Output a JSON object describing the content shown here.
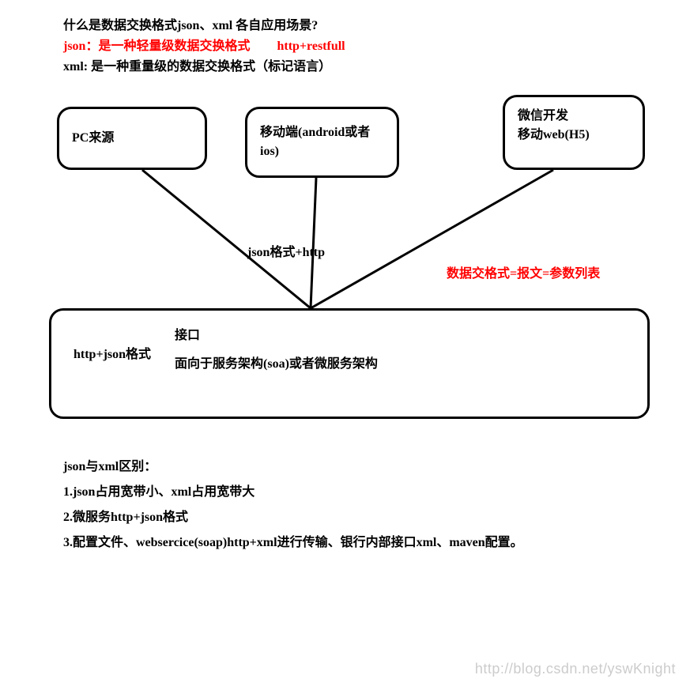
{
  "header": {
    "title": "什么是数据交换格式json、xml 各自应用场景?",
    "json_desc": "json：是一种轻量级数据交换格式",
    "json_proto": "http+restfull",
    "xml_desc": "xml: 是一种重量级的数据交换格式（标记语言）"
  },
  "boxes": {
    "pc": "PC来源",
    "mobile": "移动端(android或者ios)",
    "wechat_line1": "微信开发",
    "wechat_line2": "移动web(H5)",
    "interface_left": "http+json格式",
    "interface_right_line1": "接口",
    "interface_right_line2": "面向于服务架构(soa)或者微服务架构"
  },
  "labels": {
    "middle": "json格式+http",
    "red_note": "数据交格式=报文=参数列表"
  },
  "diff": {
    "title": "json与xml区别：",
    "item1": "1.json占用宽带小、xml占用宽带大",
    "item2": "2.微服务http+json格式",
    "item3": "3.配置文件、websercice(soap)http+xml进行传输、银行内部接口xml、maven配置。"
  },
  "watermark": "http://blog.csdn.net/yswKnight"
}
